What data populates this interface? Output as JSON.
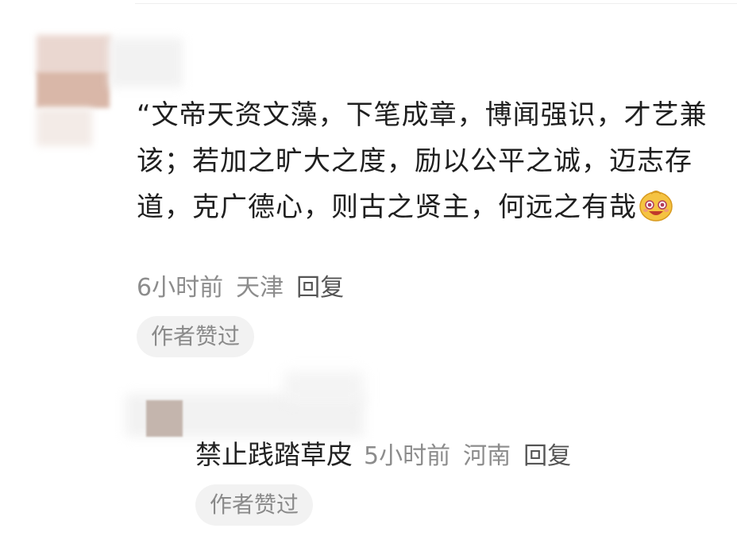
{
  "comment": {
    "text": "“文帝天资文藻，下笔成章，博闻强识，才艺兼该；若加之旷大之度，励以公平之诚，迈志存道，克广德心，则古之贤主，何远之有哉",
    "emoji": "smiling-face-emoji",
    "time": "6小时前",
    "location": "天津",
    "reply_label": "回复",
    "badge": "作者赞过"
  },
  "reply": {
    "username": "禁止践踏草皮",
    "time": "5小时前",
    "location": "河南",
    "reply_label": "回复",
    "badge": "作者赞过"
  },
  "colors": {
    "text": "#1f1f1f",
    "meta": "#8c8c8c",
    "badge_bg": "#f2f2f2",
    "emoji_face": "#f5c342"
  }
}
